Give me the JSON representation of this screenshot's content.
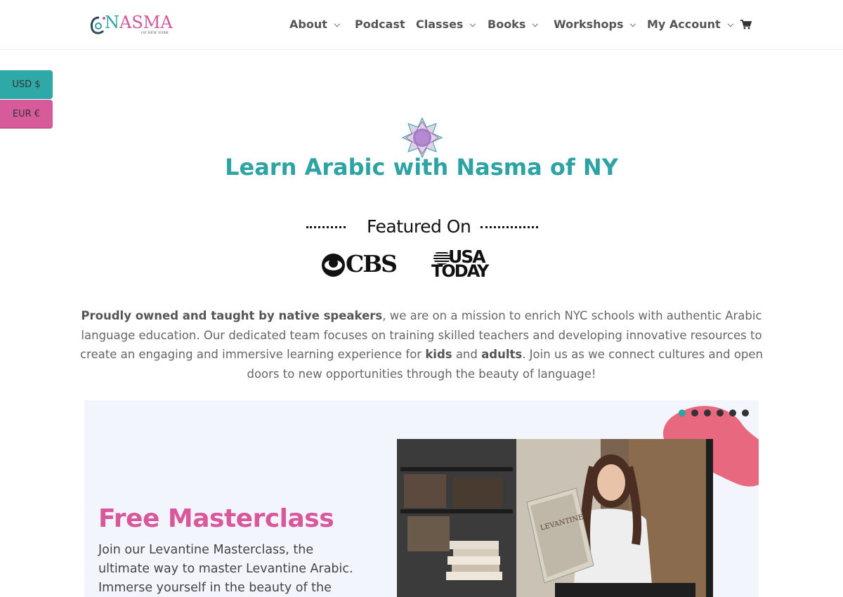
{
  "header": {
    "logo_text_1": "N",
    "logo_text_2": "ASMA",
    "logo_sub": "OF NEW YORK",
    "nav": [
      {
        "label": "About",
        "has_dropdown": true
      },
      {
        "label": "Podcast",
        "has_dropdown": false
      },
      {
        "label": "Classes",
        "has_dropdown": true
      },
      {
        "label": "Books",
        "has_dropdown": true
      },
      {
        "label": "Workshops",
        "has_dropdown": true
      },
      {
        "label": "My Account",
        "has_dropdown": true
      }
    ],
    "cart_icon": "cart-icon"
  },
  "currency": {
    "usd": "USD $",
    "eur": "EUR €"
  },
  "hero": {
    "title": "Learn Arabic with Nasma of NY",
    "featured_label": "Featured On",
    "logos": {
      "cbs": "CBS",
      "usa": "USA",
      "today": "TODAY"
    },
    "para": {
      "p1_bold": "Proudly owned and taught by native speakers",
      "p1_rest": ", we are on a mission to enrich NYC schools with authentic Arabic language education. Our dedicated team focuses on training skilled teachers and developing innovative resources to create an engaging and immersive learning experience for ",
      "kids": "kids",
      "and": " and ",
      "adults": "adults",
      "p1_end": ". Join us as we connect cultures and open doors to new opportunities through the beauty of language!"
    }
  },
  "slider": {
    "title": "Free Masterclass",
    "text": "Join our Levantine Masterclass, the ultimate way to master Levantine Arabic. Immerse yourself in the beauty of the",
    "book_title": "LEVANTINE",
    "dot_count": 6,
    "active_dot": 0,
    "colors": {
      "teal": "#2ea3a3",
      "pink": "#d9579b",
      "blob": "#e7687f"
    }
  }
}
